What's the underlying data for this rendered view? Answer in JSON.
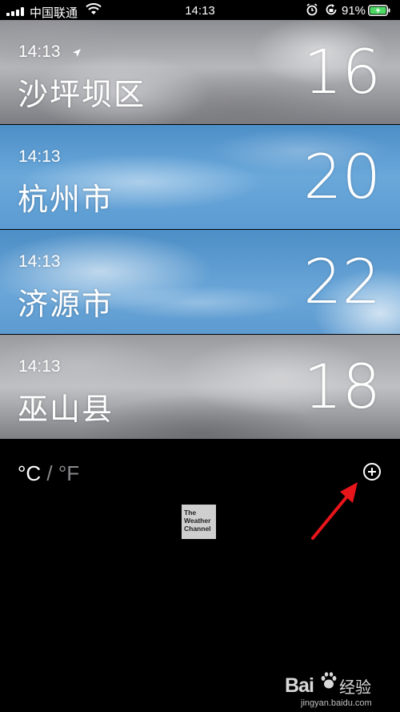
{
  "status_bar": {
    "carrier": "中国联通",
    "time": "14:13",
    "battery_percent": "91%"
  },
  "cities": [
    {
      "time": "14:13",
      "name": "沙坪坝区",
      "temp": "16",
      "current_location": true
    },
    {
      "time": "14:13",
      "name": "杭州市",
      "temp": "20",
      "current_location": false
    },
    {
      "time": "14:13",
      "name": "济源市",
      "temp": "22",
      "current_location": false
    },
    {
      "time": "14:13",
      "name": "巫山县",
      "temp": "18",
      "current_location": false
    }
  ],
  "units": {
    "celsius": "°C",
    "separator": "/",
    "fahrenheit": "°F"
  },
  "provider_logo": {
    "line1": "The",
    "line2": "Weather",
    "line3": "Channel"
  },
  "watermark": {
    "brand": "Bai",
    "brand2": "经验",
    "url": "jingyan.baidu.com"
  },
  "colors": {
    "annotation_arrow": "#e8151b",
    "background": "#000000"
  },
  "icons": [
    "signal-icon",
    "wifi-icon",
    "alarm-icon",
    "orientation-lock-icon",
    "battery-charging-icon",
    "location-arrow-icon",
    "add-city-icon"
  ]
}
